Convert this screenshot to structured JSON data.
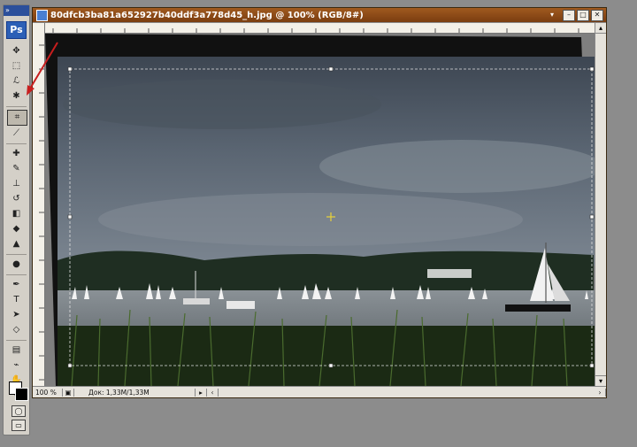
{
  "document": {
    "title": "80dfcb3ba81a652927b40ddf3a778d45_h.jpg @ 100% (RGB/8#)",
    "zoom": "100 %",
    "doc_info": "Док: 1,33M/1,33M"
  },
  "toolbox": {
    "logo": "Ps",
    "grip": "»",
    "tools": [
      {
        "name": "move-tool",
        "glyph": "✥"
      },
      {
        "name": "marquee-tool",
        "glyph": "⬚"
      },
      {
        "name": "lasso-tool",
        "glyph": "ℒ"
      },
      {
        "name": "magic-wand-tool",
        "glyph": "✱"
      },
      {
        "name": "crop-tool",
        "glyph": "⌗",
        "active": true
      },
      {
        "name": "slice-tool",
        "glyph": "⟋"
      },
      {
        "name": "healing-brush-tool",
        "glyph": "✚"
      },
      {
        "name": "brush-tool",
        "glyph": "✎"
      },
      {
        "name": "clone-stamp-tool",
        "glyph": "⊥"
      },
      {
        "name": "history-brush-tool",
        "glyph": "↺"
      },
      {
        "name": "eraser-tool",
        "glyph": "◧"
      },
      {
        "name": "paint-bucket-tool",
        "glyph": "◆"
      },
      {
        "name": "blur-tool",
        "glyph": "▲"
      },
      {
        "name": "dodge-tool",
        "glyph": "●"
      },
      {
        "name": "pen-tool",
        "glyph": "✒"
      },
      {
        "name": "type-tool",
        "glyph": "T"
      },
      {
        "name": "path-selection-tool",
        "glyph": "➤"
      },
      {
        "name": "shape-tool",
        "glyph": "◇"
      },
      {
        "name": "notes-tool",
        "glyph": "▤"
      },
      {
        "name": "eyedropper-tool",
        "glyph": "⌁"
      },
      {
        "name": "hand-tool",
        "glyph": "✋"
      },
      {
        "name": "zoom-tool",
        "glyph": "⚲"
      }
    ]
  },
  "window_buttons": {
    "minimize": "–",
    "maximize": "□",
    "close": "✕"
  },
  "colors": {
    "annotation_arrow": "#c81e1e",
    "titlebar": "#8a4515"
  }
}
